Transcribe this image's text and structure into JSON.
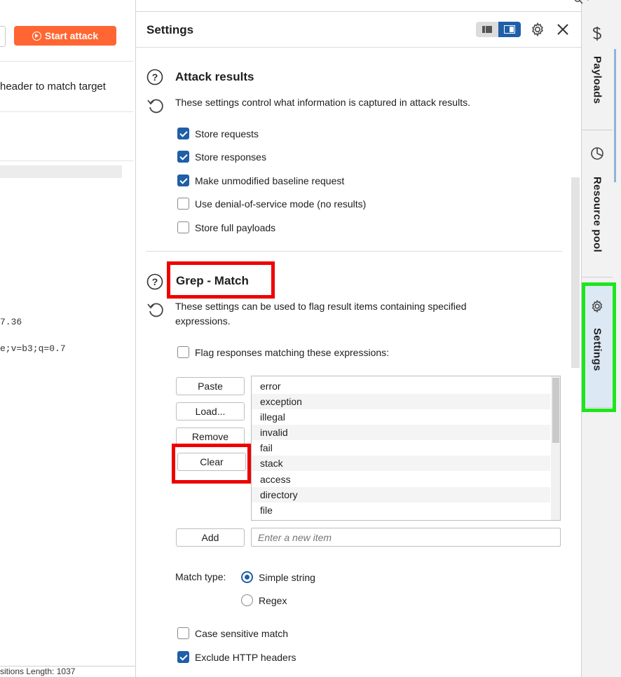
{
  "left_pane": {
    "start_attack_label": "Start attack",
    "header_match_text": "header to match target",
    "code_line_1": "7.36",
    "code_line_2": "e;v=b3;q=0.7",
    "status_text": "sitions    Length: 1037"
  },
  "settings": {
    "title": "Settings",
    "attack_results": {
      "title": "Attack results",
      "description": "These settings control what information is captured in attack results.",
      "options": [
        {
          "label": "Store requests",
          "checked": true
        },
        {
          "label": "Store responses",
          "checked": true
        },
        {
          "label": "Make unmodified baseline request",
          "checked": true
        },
        {
          "label": "Use denial-of-service mode (no results)",
          "checked": false
        },
        {
          "label": "Store full payloads",
          "checked": false
        }
      ]
    },
    "grep_match": {
      "title": "Grep - Match",
      "description_line1": "These settings can be used to flag result items containing specified",
      "description_line2": "expressions.",
      "flag_label": "Flag responses matching these expressions:",
      "flag_checked": false,
      "buttons": {
        "paste": "Paste",
        "load": "Load...",
        "remove": "Remove",
        "clear": "Clear",
        "add": "Add"
      },
      "items": [
        "error",
        "exception",
        "illegal",
        "invalid",
        "fail",
        "stack",
        "access",
        "directory",
        "file"
      ],
      "new_item_placeholder": "Enter a new item",
      "match_type_label": "Match type:",
      "match_types": [
        {
          "label": "Simple string",
          "selected": true
        },
        {
          "label": "Regex",
          "selected": false
        }
      ],
      "case_sensitive_label": "Case sensitive match",
      "case_sensitive_checked": false,
      "exclude_headers_label": "Exclude HTTP headers",
      "exclude_headers_checked": true
    }
  },
  "right_tabs": [
    {
      "label": "Payloads",
      "icon": "dollar-icon"
    },
    {
      "label": "Resource pool",
      "icon": "pie-chart-icon"
    },
    {
      "label": "Settings",
      "icon": "gear-icon",
      "active": true
    }
  ],
  "colors": {
    "accent_orange": "#ff6633",
    "checkbox_blue": "#1f5ea8",
    "annotation_red": "#ee0000",
    "annotation_green": "#1ee51e"
  }
}
